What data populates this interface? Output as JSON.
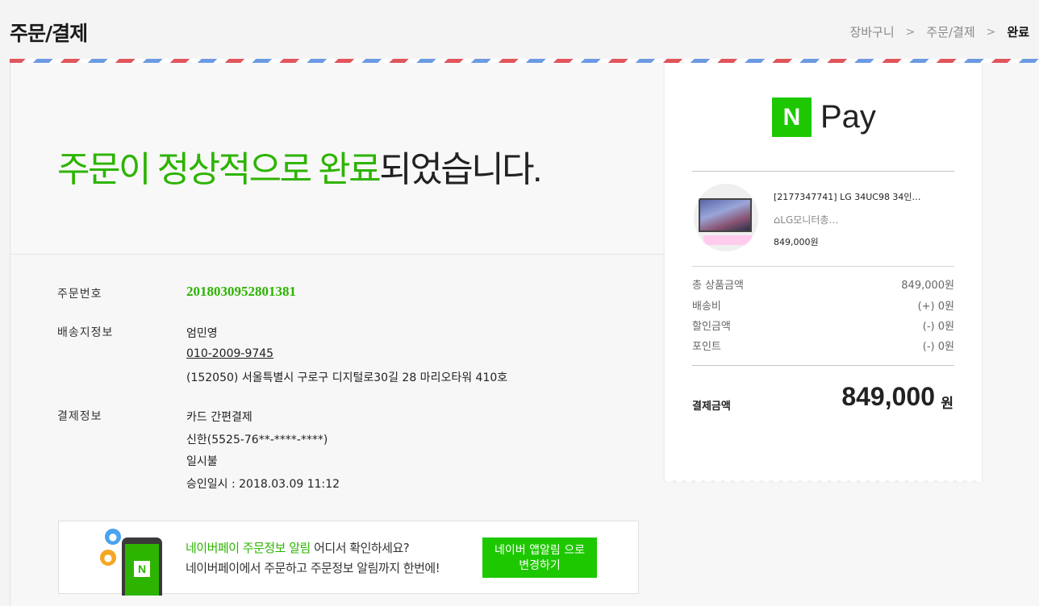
{
  "header": {
    "title": "주문/결제",
    "breadcrumb": [
      "장바구니",
      "주문/결제",
      "완료"
    ],
    "separator": ">"
  },
  "hero": {
    "headline_green": "주문이 정상적으로 완료",
    "headline_black": "되었습니다."
  },
  "order": {
    "number_label": "주문번호",
    "number": "2018030952801381",
    "shipping_label": "배송지정보",
    "recipient": "엄민영",
    "phone": "010-2009-9745",
    "address": "(152050) 서울특별시 구로구 디지털로30길 28 마리오타워 410호",
    "payment_label": "결제정보",
    "payment_method": "카드 간편결제",
    "card": "신한(5525-76**-****-****)",
    "installment": "일시불",
    "approval": "승인일시 : 2018.03.09 11:12"
  },
  "banner": {
    "line1_green": "네이버페이 주문정보 알림",
    "line1_rest": " 어디서 확인하세요?",
    "line2": "네이버페이에서 주문하고 주문정보 알림까지 한번에!",
    "button_line1": "네이버 앱알림 으로",
    "button_line2": "변경하기",
    "icon_letter": "N"
  },
  "receipt": {
    "logo_letter": "N",
    "logo_text": "Pay",
    "product_name": "[2177347741] LG 34UC98 34인…",
    "seller": "LG모니터총…",
    "product_price": "849,000원",
    "rows": [
      {
        "label": "총 상품금액",
        "value": "849,000원"
      },
      {
        "label": "배송비",
        "value": "(+) 0원"
      },
      {
        "label": "할인금액",
        "value": "(-) 0원"
      },
      {
        "label": "포인트",
        "value": "(-) 0원"
      }
    ],
    "total_label": "결제금액",
    "total_value": "849,000",
    "total_unit": "원"
  },
  "colors": {
    "naver_green": "#1ec800",
    "accent_green": "#2db400"
  }
}
